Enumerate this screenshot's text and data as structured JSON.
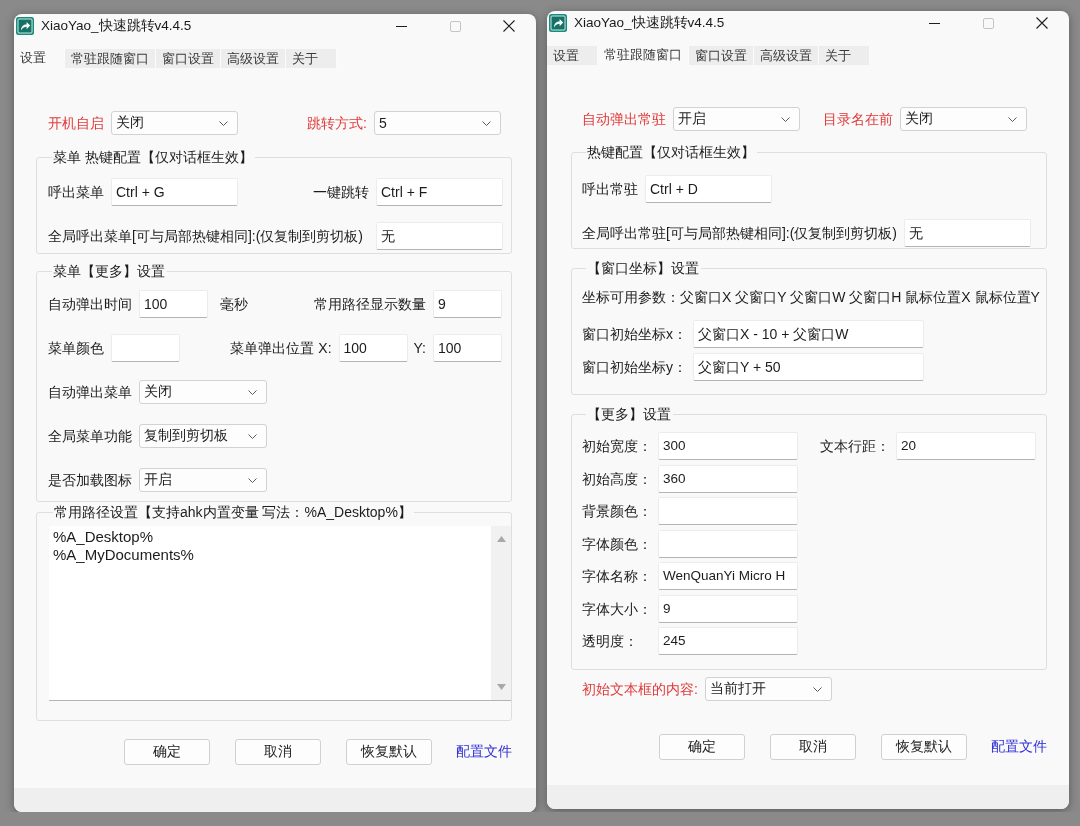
{
  "windows": [
    {
      "title": "XiaoYao_快速跳转v4.4.5",
      "controls": [
        {
          "kind": "minimize",
          "disabled": false
        },
        {
          "kind": "maximize",
          "disabled": true
        },
        {
          "kind": "close",
          "disabled": false
        }
      ],
      "tabs": [
        {
          "label": "设置",
          "selected": true
        },
        {
          "label": "常驻跟随窗口",
          "selected": false
        },
        {
          "label": "窗口设置",
          "selected": false
        },
        {
          "label": "高级设置",
          "selected": false
        },
        {
          "label": "关于",
          "selected": false
        }
      ],
      "sections": [
        {
          "kind": "row",
          "entries": [
            {
              "kind": "dropdown",
              "label": "开机自启",
              "highlighted": true,
              "value": "关闭"
            },
            {
              "kind": "dropdown",
              "label": "跳转方式:",
              "highlighted": true,
              "value": "5"
            }
          ]
        },
        {
          "kind": "group",
          "title": "菜单 热键配置【仅对话框生效】",
          "rows": [
            {
              "entries": [
                {
                  "kind": "textbox",
                  "label": "呼出菜单",
                  "highlighted": false,
                  "value": "Ctrl + G"
                },
                {
                  "kind": "textbox",
                  "label": "一键跳转",
                  "highlighted": false,
                  "value": "Ctrl + F"
                }
              ]
            },
            {
              "entries": [
                {
                  "kind": "textbox",
                  "label": "全局呼出菜单[可与局部热键相同]:(仅复制到剪切板)",
                  "highlighted": false,
                  "value": "无"
                }
              ]
            }
          ]
        },
        {
          "kind": "group",
          "title": "菜单【更多】设置",
          "rows": [
            {
              "entries": [
                {
                  "kind": "textbox",
                  "label": "自动弹出时间",
                  "highlighted": false,
                  "value": "100",
                  "unit": "毫秒"
                },
                {
                  "kind": "textbox",
                  "label": "常用路径显示数量",
                  "highlighted": false,
                  "value": "9"
                }
              ]
            },
            {
              "entries": [
                {
                  "kind": "textbox",
                  "label": "菜单颜色",
                  "highlighted": false
                },
                {
                  "kind": "textbox",
                  "label": "菜单弹出位置 X:",
                  "highlighted": false,
                  "value": "100"
                },
                {
                  "kind": "textbox",
                  "label": "Y:",
                  "highlighted": false,
                  "value": "100"
                }
              ]
            },
            {
              "entries": [
                {
                  "kind": "dropdown",
                  "label": "自动弹出菜单",
                  "highlighted": false,
                  "value": "关闭"
                }
              ]
            },
            {
              "entries": [
                {
                  "kind": "dropdown",
                  "label": "全局菜单功能",
                  "highlighted": false,
                  "value": "复制到剪切板"
                }
              ]
            },
            {
              "entries": [
                {
                  "kind": "dropdown",
                  "label": "是否加载图标",
                  "highlighted": false,
                  "value": "开启"
                }
              ]
            }
          ]
        },
        {
          "kind": "group",
          "title": "常用路径设置【支持ahk内置变量 写法：%A_Desktop%】",
          "rows": [
            {
              "entries": [
                {
                  "kind": "textarea",
                  "lines": [
                    "%A_Desktop%",
                    "%A_MyDocuments%"
                  ]
                }
              ]
            }
          ]
        }
      ],
      "buttons": [
        "确定",
        "取消",
        "恢复默认"
      ],
      "link": "配置文件"
    },
    {
      "title": "XiaoYao_快速跳转v4.4.5",
      "controls": [
        {
          "kind": "minimize",
          "disabled": false
        },
        {
          "kind": "maximize",
          "disabled": true
        },
        {
          "kind": "close",
          "disabled": false
        }
      ],
      "tabs": [
        {
          "label": "设置",
          "selected": false
        },
        {
          "label": "常驻跟随窗口",
          "selected": true
        },
        {
          "label": "窗口设置",
          "selected": false
        },
        {
          "label": "高级设置",
          "selected": false
        },
        {
          "label": "关于",
          "selected": false
        }
      ],
      "sections": [
        {
          "kind": "row",
          "entries": [
            {
              "kind": "dropdown",
              "label": "自动弹出常驻",
              "highlighted": true,
              "value": "开启"
            },
            {
              "kind": "dropdown",
              "label": "目录名在前",
              "highlighted": true,
              "value": "关闭"
            }
          ]
        },
        {
          "kind": "group",
          "title": "热键配置【仅对话框生效】",
          "rows": [
            {
              "entries": [
                {
                  "kind": "textbox",
                  "label": "呼出常驻",
                  "highlighted": false,
                  "value": "Ctrl + D"
                }
              ]
            },
            {
              "entries": [
                {
                  "kind": "textbox",
                  "label": "全局呼出常驻[可与局部热键相同]:(仅复制到剪切板)",
                  "highlighted": false,
                  "value": "无"
                }
              ]
            }
          ]
        },
        {
          "kind": "group",
          "title": "【窗口坐标】设置",
          "rows": [
            {
              "entries": [
                {
                  "kind": "text",
                  "text": "坐标可用参数：父窗口X 父窗口Y 父窗口W 父窗口H 鼠标位置X 鼠标位置Y"
                }
              ]
            },
            {
              "entries": [
                {
                  "kind": "textbox",
                  "label": "窗口初始坐标x：",
                  "highlighted": false,
                  "value": "父窗口X - 10 + 父窗口W"
                }
              ]
            },
            {
              "entries": [
                {
                  "kind": "textbox",
                  "label": "窗口初始坐标y：",
                  "highlighted": false,
                  "value": "父窗口Y + 50"
                }
              ]
            }
          ]
        },
        {
          "kind": "group",
          "title": "【更多】设置",
          "rows": [
            {
              "entries": [
                {
                  "kind": "textbox",
                  "label": "初始宽度：",
                  "highlighted": false,
                  "value": "300"
                },
                {
                  "kind": "textbox",
                  "label": "文本行距：",
                  "highlighted": false,
                  "value": "20"
                }
              ]
            },
            {
              "entries": [
                {
                  "kind": "textbox",
                  "label": "初始高度：",
                  "highlighted": false,
                  "value": "360"
                }
              ]
            },
            {
              "entries": [
                {
                  "kind": "textbox",
                  "label": "背景颜色：",
                  "highlighted": false
                }
              ]
            },
            {
              "entries": [
                {
                  "kind": "textbox",
                  "label": "字体颜色：",
                  "highlighted": false
                }
              ]
            },
            {
              "entries": [
                {
                  "kind": "textbox",
                  "label": "字体名称：",
                  "highlighted": false,
                  "value": "WenQuanYi Micro H"
                }
              ]
            },
            {
              "entries": [
                {
                  "kind": "textbox",
                  "label": "字体大小：",
                  "highlighted": false,
                  "value": "9"
                }
              ]
            },
            {
              "entries": [
                {
                  "kind": "textbox",
                  "label": "透明度：",
                  "highlighted": false,
                  "value": "245"
                }
              ]
            }
          ]
        },
        {
          "kind": "row",
          "entries": [
            {
              "kind": "dropdown",
              "label": "初始文本框的内容:",
              "highlighted": true,
              "value": "当前打开"
            }
          ]
        }
      ],
      "buttons": [
        "确定",
        "取消",
        "恢复默认"
      ],
      "link": "配置文件"
    }
  ]
}
